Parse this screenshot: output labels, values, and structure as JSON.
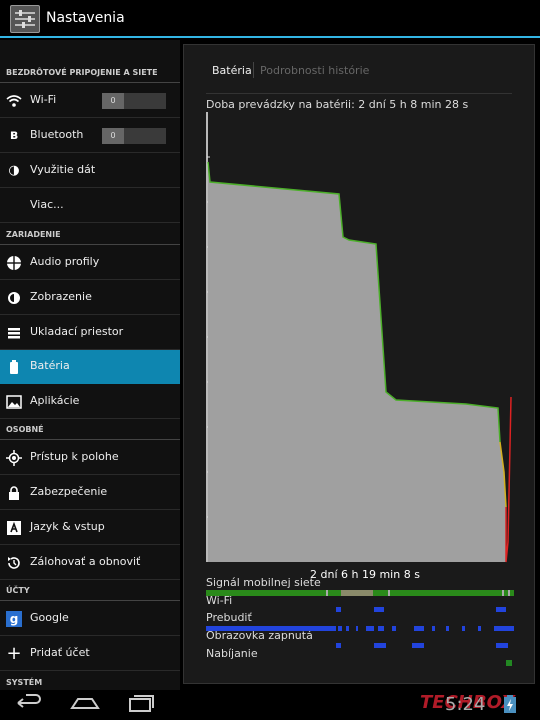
{
  "header": {
    "title": "Nastavenia"
  },
  "sidebar": {
    "sections": [
      "BEZDRÔTOVÉ PRIPOJENIE A SIETE",
      "ZARIADENIE",
      "OSOBNÉ",
      "ÚČTY",
      "SYSTÉM"
    ],
    "items": [
      {
        "label": "Wi-Fi",
        "icon": "wifi-icon",
        "toggle": "0"
      },
      {
        "label": "Bluetooth",
        "icon": "bluetooth-icon",
        "toggle": "0"
      },
      {
        "label": "Využitie dát",
        "icon": "data-usage-icon"
      },
      {
        "label": "Viac..."
      },
      {
        "label": "Audio profily",
        "icon": "audio-profiles-icon"
      },
      {
        "label": "Zobrazenie",
        "icon": "display-icon"
      },
      {
        "label": "Ukladací priestor",
        "icon": "storage-icon"
      },
      {
        "label": "Batéria",
        "icon": "battery-icon",
        "active": true
      },
      {
        "label": "Aplikácie",
        "icon": "apps-icon"
      },
      {
        "label": "Prístup k polohe",
        "icon": "location-icon"
      },
      {
        "label": "Zabezpečenie",
        "icon": "lock-icon"
      },
      {
        "label": "Jazyk & vstup",
        "icon": "language-icon"
      },
      {
        "label": "Zálohovať a obnoviť",
        "icon": "backup-icon"
      },
      {
        "label": "Google",
        "icon": "google-icon"
      },
      {
        "label": "Pridať účet",
        "icon": "add-icon"
      }
    ]
  },
  "main": {
    "tabs": [
      "Batéria",
      "Podrobnosti histórie"
    ],
    "uptime": "Doba prevádzky na batérii: 2 dní 5 h 8 min 28 s",
    "duration": "2 dní 6 h 19 min 8 s",
    "tracks": [
      "Signál mobilnej siete",
      "Wi-Fi",
      "Prebudiť",
      "Obrazovka zapnutá",
      "Nabíjanie"
    ]
  },
  "status": {
    "clock": "5:24",
    "watermark": "TECHBOX"
  },
  "colors": {
    "accent": "#33b5e5",
    "active_item": "#0e86b0",
    "graph_fill": "#a0a0a0",
    "graph_line": "#4caf2a",
    "track_blue": "#2244dd",
    "track_green": "#228822"
  }
}
